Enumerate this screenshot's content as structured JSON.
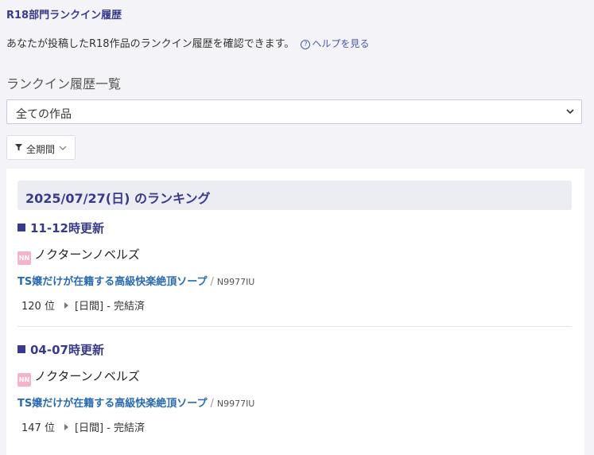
{
  "header": {
    "title": "R18部門ランクイン履歴"
  },
  "intro": {
    "text": "あなたが投稿したR18作品のランクイン履歴を確認できます。",
    "help_icon": "?",
    "help_label": "ヘルプを見る"
  },
  "section": {
    "title": "ランクイン履歴一覧"
  },
  "work_select": {
    "selected": "全ての作品"
  },
  "period_filter": {
    "label": "全期間"
  },
  "ranking": {
    "date_header": "2025/07/27(日) のランキング",
    "entries": [
      {
        "time": "11-12時更新",
        "site_icon": "NN",
        "site": "ノクターンノベルズ",
        "work_title": "TS嬢だけが在籍する高級快楽絶頂ソープ",
        "separator": "/",
        "ncode": "N9977IU",
        "rank": "120 位",
        "detail": "[日間] - 完結済"
      },
      {
        "time": "04-07時更新",
        "site_icon": "NN",
        "site": "ノクターンノベルズ",
        "work_title": "TS嬢だけが在籍する高級快楽絶頂ソープ",
        "separator": "/",
        "ncode": "N9977IU",
        "rank": "147 位",
        "detail": "[日間] - 完結済"
      }
    ]
  },
  "colors": {
    "accent": "#3a3a8c",
    "link": "#2a6bb0",
    "background": "#f4f4f8",
    "nn_badge": "#f6b3c8"
  }
}
